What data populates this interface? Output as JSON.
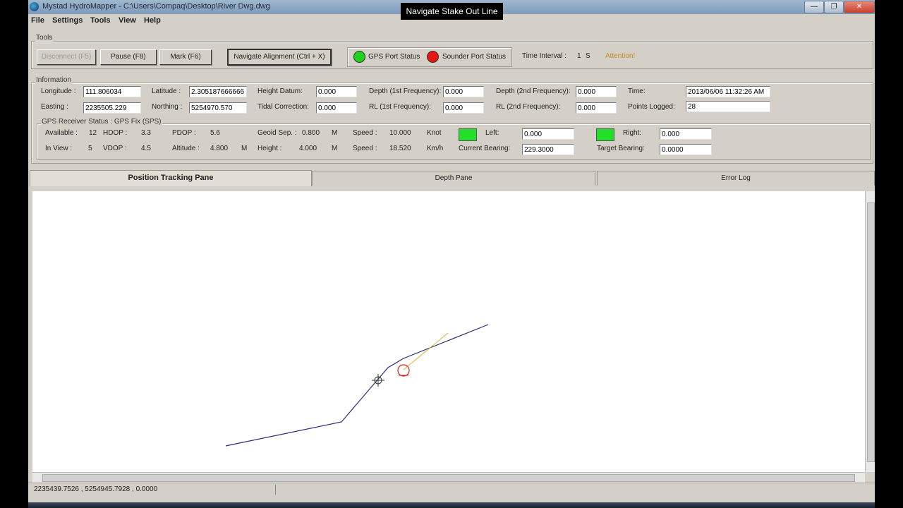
{
  "window": {
    "title": "Mystad HydroMapper - C:\\Users\\Compaq\\Desktop\\River Dwg.dwg",
    "minimize_glyph": "—",
    "maximize_glyph": "❐",
    "close_glyph": "✕"
  },
  "tooltip": "Navigate Stake Out Line",
  "menu": [
    "File",
    "Settings",
    "Tools",
    "View",
    "Help"
  ],
  "tools": {
    "group_label": "Tools",
    "disconnect_label": "Disconnect (F5)",
    "pause_label": "Pause (F8)",
    "mark_label": "Mark (F6)",
    "navigate_label": "Navigate Alignment (Ctrl + X)",
    "gps_port_label": "GPS Port Status",
    "gps_port_color": "#1ed21e",
    "sounder_port_label": "Sounder Port Status",
    "sounder_port_color": "#e81515",
    "time_interval_label": "Time Interval :",
    "time_interval_value": "1",
    "time_interval_unit": "S",
    "attention_label": "Attention!",
    "attention_color": "#c88a1e"
  },
  "info": {
    "group_label": "Information",
    "longitude_label": "Longitude :",
    "longitude_value": "111.806034",
    "latitude_label": "Latitude :",
    "latitude_value": "2.305187666666",
    "height_datum_label": "Height Datum:",
    "height_datum_value": "0.000",
    "depth1_label": "Depth (1st Frequency):",
    "depth1_value": "0.000",
    "depth2_label": "Depth (2nd Frequency):",
    "depth2_value": "0.000",
    "time_label": "Time:",
    "time_value": "2013/06/06 11:32:26 AM",
    "easting_label": "Easting :",
    "easting_value": "2235505.229",
    "northing_label": "Northing :",
    "northing_value": "5254970.570",
    "tidal_label": "Tidal Correction:",
    "tidal_value": "0.000",
    "rl1_label": "RL (1st Frequency):",
    "rl1_value": "0.000",
    "rl2_label": "RL (2nd Frequency):",
    "rl2_value": "0.000",
    "points_label": "Points Logged:",
    "points_value": "28"
  },
  "gps": {
    "group_label": "GPS Receiver   Status : GPS Fix (SPS)",
    "available_label": "Available :",
    "available_value": "12",
    "hdop_label": "HDOP :",
    "hdop_value": "3.3",
    "pdop_label": "PDOP :",
    "pdop_value": "5.6",
    "geoid_label": "Geoid Sep. :",
    "geoid_value": "0.800",
    "geoid_unit": "M",
    "speed1_label": "Speed :",
    "speed1_value": "10.000",
    "speed1_unit": "Knot",
    "left_label": "Left:",
    "left_value": "0.000",
    "right_label": "Right:",
    "right_value": "0.000",
    "inview_label": "In View :",
    "inview_value": "5",
    "vdop_label": "VDOP :",
    "vdop_value": "4.5",
    "altitude_label": "Altitude :",
    "altitude_value": "4.800",
    "altitude_unit": "M",
    "height_label": "Height :",
    "height_value": "4.000",
    "height_unit": "M",
    "speed2_label": "Speed :",
    "speed2_value": "18.520",
    "speed2_unit": "Km/h",
    "current_bearing_label": "Current  Bearing:",
    "current_bearing_value": "229.3000",
    "target_bearing_label": "Target  Bearing:",
    "target_bearing_value": "0.0000",
    "left_indicator_color": "#22e02a",
    "right_indicator_color": "#22e02a"
  },
  "tabs": [
    "Position Tracking Pane",
    "Depth Pane",
    "Error Log"
  ],
  "status_bar": {
    "coords": "2235439.7526 , 5254945.7928 , 0.0000"
  },
  "map": {
    "alignment_color": "#2a2a7a",
    "bearing_line_color": "#e0b030",
    "vessel_color": "#d02020",
    "cursor_color": "#333333"
  }
}
